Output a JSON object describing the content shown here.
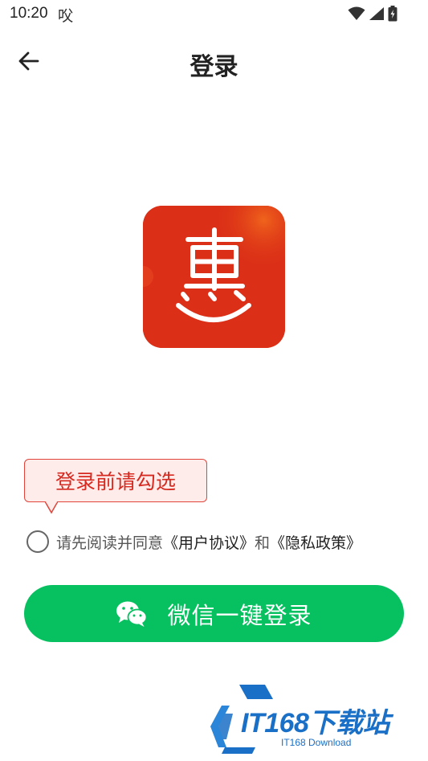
{
  "status_bar": {
    "time": "10:20",
    "extra_glyph": "㕮"
  },
  "nav": {
    "title": "登录"
  },
  "tooltip": {
    "text": "登录前请勾选"
  },
  "agreement": {
    "prefix": "请先阅读并同意",
    "user_agreement": "《用户协议》",
    "conjunction": "和",
    "privacy_policy": "《隐私政策》",
    "checked": false
  },
  "login_button": {
    "label": "微信一键登录"
  },
  "watermark": {
    "text": "IT168下载站",
    "subtext": "IT168 Download"
  },
  "colors": {
    "accent_green": "#07c160",
    "logo_red": "#db3017",
    "tooltip_red": "#d62a20",
    "watermark_blue": "#1a6fc6"
  },
  "icons": {
    "back": "arrow-left-icon",
    "wifi": "wifi-icon",
    "signal": "cell-signal-icon",
    "battery": "battery-charging-icon",
    "logo": "hui-smile-logo",
    "wechat": "wechat-icon"
  }
}
